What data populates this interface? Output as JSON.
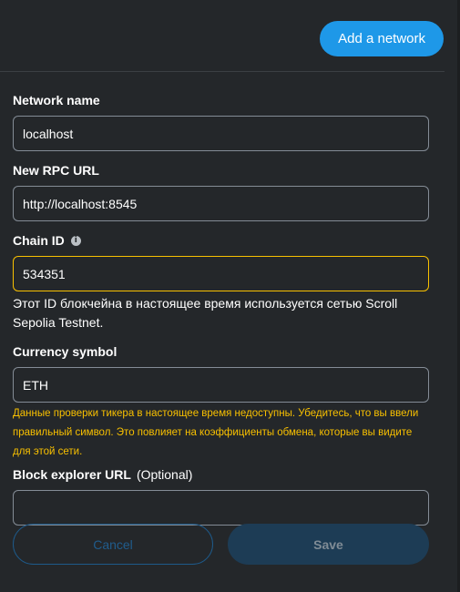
{
  "header": {
    "add_network_label": "Add a network"
  },
  "form": {
    "network_name": {
      "label": "Network name",
      "value": "localhost"
    },
    "rpc_url": {
      "label": "New RPC URL",
      "value": "http://localhost:8545"
    },
    "chain_id": {
      "label": "Chain ID",
      "info_icon": "info-icon",
      "info_glyph": "i",
      "value": "534351",
      "note": "Этот ID блокчейна в настоящее время используется сетью Scroll Sepolia Testnet."
    },
    "currency_symbol": {
      "label": "Currency symbol",
      "value": "ETH",
      "warning": "Данные проверки тикера в настоящее время недоступны. Убедитесь, что вы ввели правильный символ. Это повлияет на коэффициенты обмена, которые вы видите для этой сети."
    },
    "block_explorer": {
      "label": "Block explorer URL",
      "optional": "(Optional)",
      "value": ""
    }
  },
  "actions": {
    "cancel_label": "Cancel",
    "save_label": "Save"
  },
  "colors": {
    "background": "#24272a",
    "accent": "#1e98e8",
    "warning": "#f8c000",
    "input_border": "#848c96"
  }
}
